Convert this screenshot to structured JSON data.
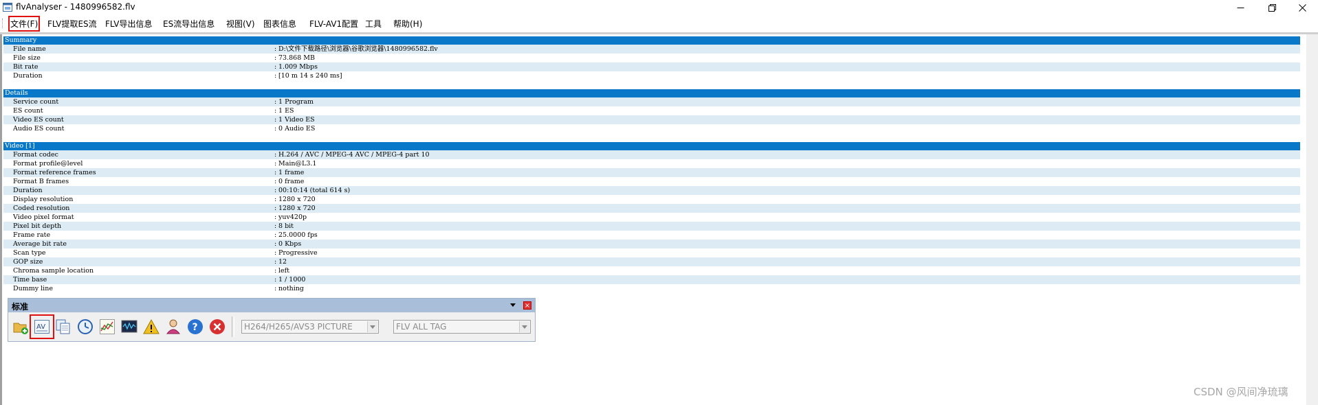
{
  "window": {
    "title": "flvAnalyser - 1480996582.flv"
  },
  "menu": [
    {
      "label": "文件(F)",
      "active": true
    },
    {
      "label": "FLV提取ES流"
    },
    {
      "label": "FLV导出信息"
    },
    {
      "label": "ES流导出信息"
    },
    {
      "label": "视图(V)"
    },
    {
      "label": "图表信息"
    },
    {
      "label": "FLV-AV1配置"
    },
    {
      "label": "工具"
    },
    {
      "label": "帮助(H)"
    }
  ],
  "report": [
    {
      "type": "header",
      "label": "Summary"
    },
    {
      "key": "File name",
      "value": "D:\\文件下载路径\\浏览器\\谷歌浏览器\\1480996582.flv"
    },
    {
      "key": "File size",
      "value": "73.868 MB"
    },
    {
      "key": "Bit rate",
      "value": "1.009 Mbps"
    },
    {
      "key": "Duration",
      "value": "[10 m 14 s 240 ms]"
    },
    {
      "type": "blank"
    },
    {
      "type": "header",
      "label": "Details"
    },
    {
      "key": "Service count",
      "value": "1 Program"
    },
    {
      "key": "ES count",
      "value": "1 ES"
    },
    {
      "key": "Video ES count",
      "value": "1 Video ES"
    },
    {
      "key": "Audio ES count",
      "value": "0 Audio ES"
    },
    {
      "type": "blank"
    },
    {
      "type": "header",
      "label": "Video [1]"
    },
    {
      "key": "Format codec",
      "value": "H.264 / AVC / MPEG-4 AVC / MPEG-4 part 10"
    },
    {
      "key": "Format profile@level",
      "value": "Main@L3.1"
    },
    {
      "key": "Format reference frames",
      "value": "1 frame"
    },
    {
      "key": "Format B frames",
      "value": "0 frame"
    },
    {
      "key": "Duration",
      "value": "00:10:14 (total 614 s)"
    },
    {
      "key": "Display resolution",
      "value": "1280 x 720"
    },
    {
      "key": "Coded resolution",
      "value": "1280 x 720"
    },
    {
      "key": "Video pixel format",
      "value": "yuv420p"
    },
    {
      "key": "Pixel bit depth",
      "value": "8 bit"
    },
    {
      "key": "Frame rate",
      "value": "25.0000 fps"
    },
    {
      "key": "Average bit rate",
      "value": "0 Kbps"
    },
    {
      "key": "Scan type",
      "value": "Progressive"
    },
    {
      "key": "GOP size",
      "value": "12"
    },
    {
      "key": "Chroma sample location",
      "value": "left"
    },
    {
      "key": "Time base",
      "value": "1 / 1000"
    },
    {
      "key": "Dummy line",
      "value": "nothing"
    }
  ],
  "toolbar": {
    "title": "标准",
    "icons": [
      {
        "name": "open-file-icon"
      },
      {
        "name": "av-icon",
        "highlighted": true
      },
      {
        "name": "copy-icon"
      },
      {
        "name": "clock-icon"
      },
      {
        "name": "line-chart-icon"
      },
      {
        "name": "waveform-icon"
      },
      {
        "name": "warning-icon"
      },
      {
        "name": "user-icon"
      },
      {
        "name": "help-icon"
      },
      {
        "name": "stop-icon"
      }
    ],
    "combo1": "H264/H265/AVS3 PICTURE",
    "combo2": "FLV ALL TAG"
  },
  "watermark": "CSDN @风间净琉璃"
}
